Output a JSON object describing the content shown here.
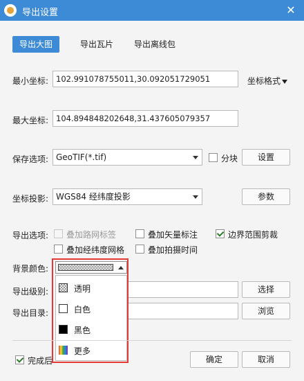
{
  "window": {
    "title": "导出设置"
  },
  "tabs": [
    {
      "label": "导出大图",
      "active": true
    },
    {
      "label": "导出瓦片",
      "active": false
    },
    {
      "label": "导出离线包",
      "active": false
    }
  ],
  "coords": {
    "min_label": "最小坐标:",
    "min_value": "102.991078755011,30.092051729051",
    "format_label": "坐标格式",
    "max_label": "最大坐标:",
    "max_value": "104.894848202648,31.437605079357"
  },
  "save": {
    "label": "保存选项:",
    "value": "GeoTIF(*.tif)",
    "tile_checkbox": "分块",
    "tile_checked": false,
    "settings_button": "设置"
  },
  "projection": {
    "label": "坐标投影:",
    "value": "WGS84 经纬度投影",
    "params_button": "参数"
  },
  "export_options": {
    "label": "导出选项:",
    "items": [
      {
        "label": "叠加路网标签",
        "checked": false,
        "disabled": true
      },
      {
        "label": "叠加矢量标注",
        "checked": false,
        "disabled": false
      },
      {
        "label": "边界范围剪裁",
        "checked": true,
        "disabled": false
      },
      {
        "label": "叠加经纬度网格",
        "checked": false,
        "disabled": false
      },
      {
        "label": "叠加拍摄时间",
        "checked": false,
        "disabled": false
      }
    ]
  },
  "background": {
    "label": "背景颜色:",
    "options": [
      {
        "label": "透明",
        "swatch": "transparent"
      },
      {
        "label": "白色",
        "swatch": "#ffffff"
      },
      {
        "label": "黑色",
        "swatch": "#000000"
      },
      {
        "label": "更多",
        "swatch": "rainbow"
      }
    ],
    "highlight_color": "#e53935"
  },
  "level": {
    "label": "导出级别:",
    "button": "选择"
  },
  "directory": {
    "label": "导出目录:",
    "button": "浏览"
  },
  "footer": {
    "after_complete": "完成后",
    "after_complete_checked": true,
    "ok_button": "确定",
    "cancel_button": "取消"
  },
  "colors": {
    "accent": "#3d8ad6",
    "background": "#f4f4f4"
  }
}
